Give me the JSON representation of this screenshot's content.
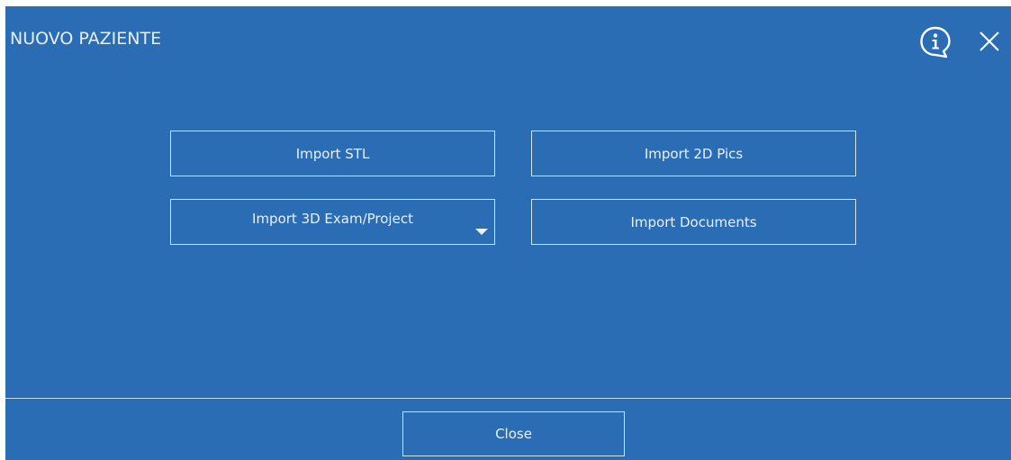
{
  "dialog": {
    "title": "NUOVO PAZIENTE",
    "icons": {
      "info": "info-icon",
      "close": "close-icon"
    }
  },
  "actions": {
    "import_stl": "Import STL",
    "import_2d_pics": "Import 2D Pics",
    "import_3d_exam_project": "Import 3D Exam/Project",
    "import_documents": "Import Documents"
  },
  "footer": {
    "close_label": "Close"
  },
  "colors": {
    "background": "#2b6db4",
    "border": "#d6e3f3",
    "text": "#e9f0f9"
  }
}
